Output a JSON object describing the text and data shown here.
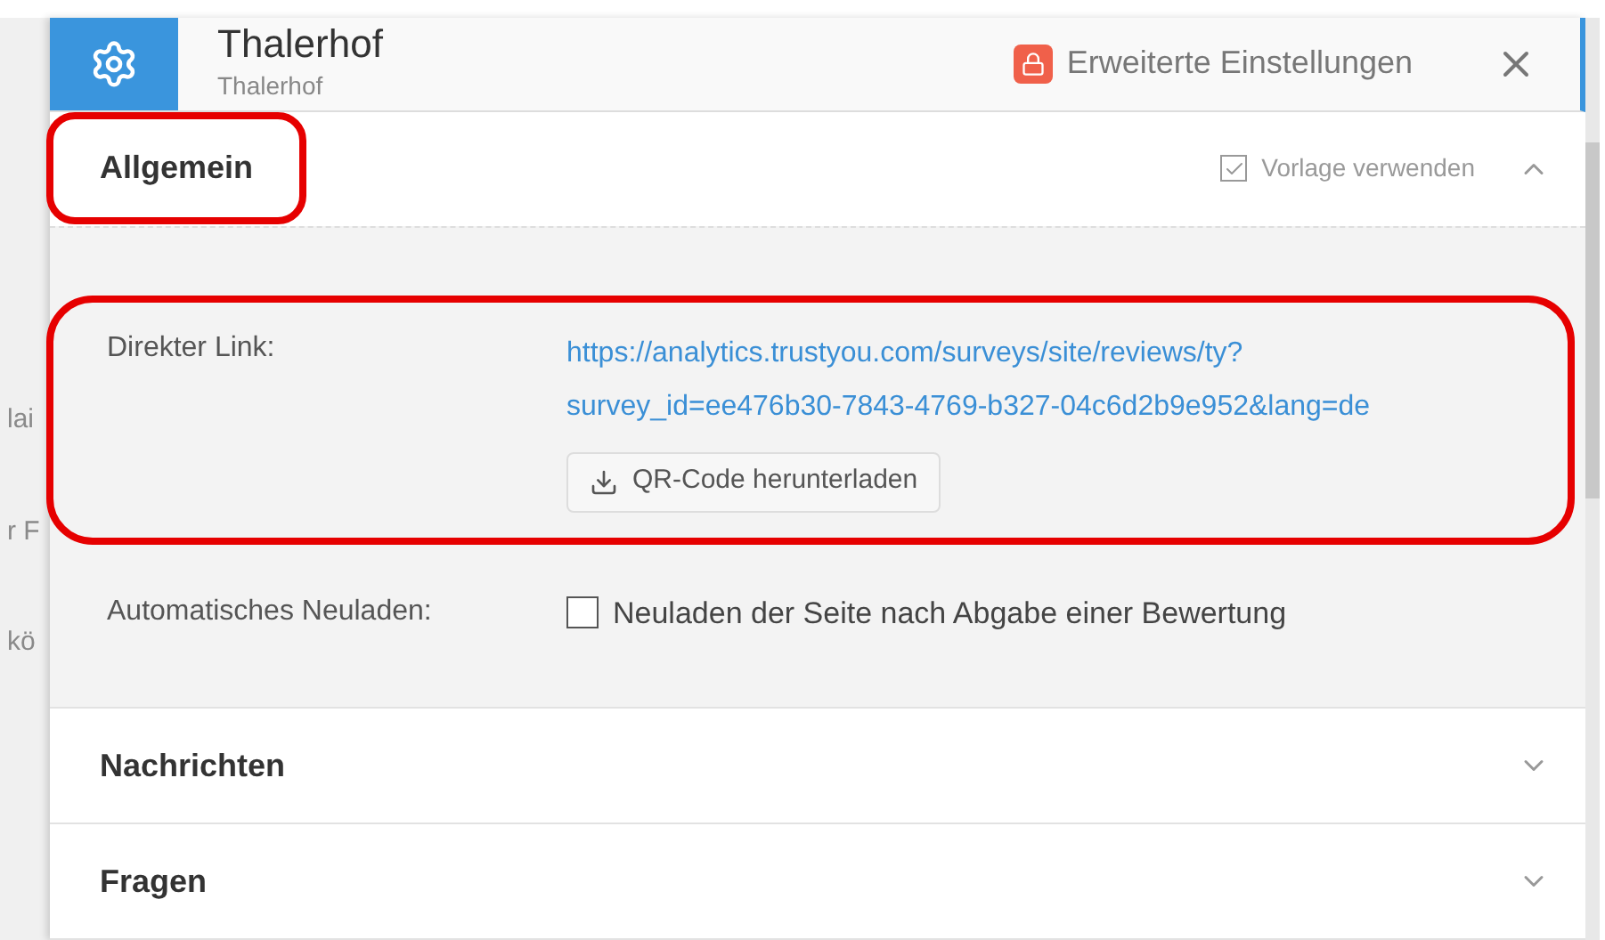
{
  "background_fragments": [
    "lai",
    "r F",
    "kö"
  ],
  "header": {
    "title": "Thalerhof",
    "subtitle": "Thalerhof",
    "advanced_settings": "Erweiterte Einstellungen"
  },
  "sections": [
    {
      "title": "Allgemein",
      "expanded": true,
      "highlighted": true,
      "use_template": {
        "label": "Vorlage verwenden",
        "checked": true
      },
      "fields": [
        {
          "kind": "link",
          "label": "Direkter Link:",
          "highlighted": true,
          "lines": [
            "https://analytics.trustyou.com/surveys/site/reviews/ty?",
            "survey_id=ee476b30-7843-4769-b327-04c6d2b9e952&lang=de"
          ],
          "button": "QR-Code herunterladen"
        },
        {
          "kind": "checkbox",
          "label": "Automatisches Neuladen:",
          "highlighted": false,
          "text": "Neuladen der Seite nach Abgabe einer Bewertung",
          "checked": false
        }
      ]
    },
    {
      "title": "Nachrichten",
      "expanded": false,
      "highlighted": false
    },
    {
      "title": "Fragen",
      "expanded": false,
      "highlighted": false
    }
  ]
}
